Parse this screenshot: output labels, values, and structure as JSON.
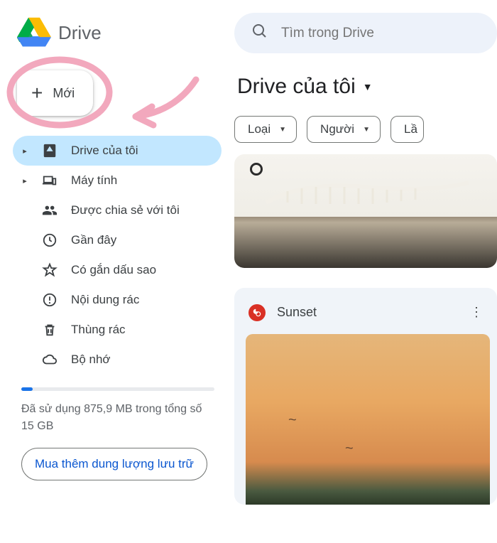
{
  "brand": {
    "title": "Drive"
  },
  "new_button": {
    "label": "Mới"
  },
  "sidebar": {
    "items": [
      {
        "label": "Drive của tôi",
        "icon": "drive",
        "selected": true,
        "caret": true
      },
      {
        "label": "Máy tính",
        "icon": "devices",
        "caret": true
      },
      {
        "label": "Được chia sẻ với tôi",
        "icon": "shared"
      },
      {
        "label": "Gần đây",
        "icon": "recent"
      },
      {
        "label": "Có gắn dấu sao",
        "icon": "star"
      },
      {
        "label": "Nội dung rác",
        "icon": "spam"
      },
      {
        "label": "Thùng rác",
        "icon": "trash"
      },
      {
        "label": "Bộ nhớ",
        "icon": "cloud"
      }
    ]
  },
  "storage": {
    "text": "Đã sử dụng 875,9 MB trong tổng số 15 GB",
    "buy_label": "Mua thêm dung lượng lưu trữ"
  },
  "search": {
    "placeholder": "Tìm trong Drive"
  },
  "page_title": "Drive của tôi",
  "filters": [
    {
      "label": "Loại"
    },
    {
      "label": "Người"
    },
    {
      "label": "Lầ"
    }
  ],
  "file_card": {
    "title": "Sunset"
  }
}
